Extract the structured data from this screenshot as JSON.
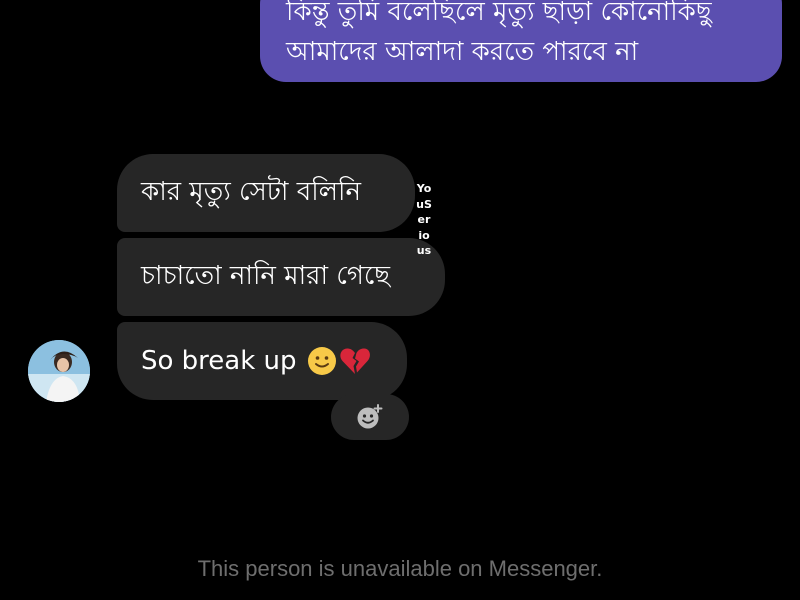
{
  "conversation": {
    "sent_message": {
      "line1": "কিন্তু তুমি বলেছিলে মৃত্যু ছাড়া কোনোকিছু",
      "line2": "আমাদের আলাদা করতে পারবে না"
    },
    "received_messages": [
      {
        "text": "কার মৃত্যু সেটা বলিনি"
      },
      {
        "text": "চাচাতো নানি মারা গেছে"
      },
      {
        "text": "So break up",
        "emojis": [
          "slightly-smiling-face-icon",
          "broken-heart-icon"
        ]
      }
    ],
    "watermark": "YouSerious",
    "add_reaction_icon": "add-reaction-icon"
  },
  "colors": {
    "background": "#000000",
    "sent_bubble": "#5b4fb0",
    "received_bubble": "#262626",
    "status_text": "#6e6e6e"
  },
  "footer": {
    "status_text": "This person is unavailable on Messenger."
  }
}
